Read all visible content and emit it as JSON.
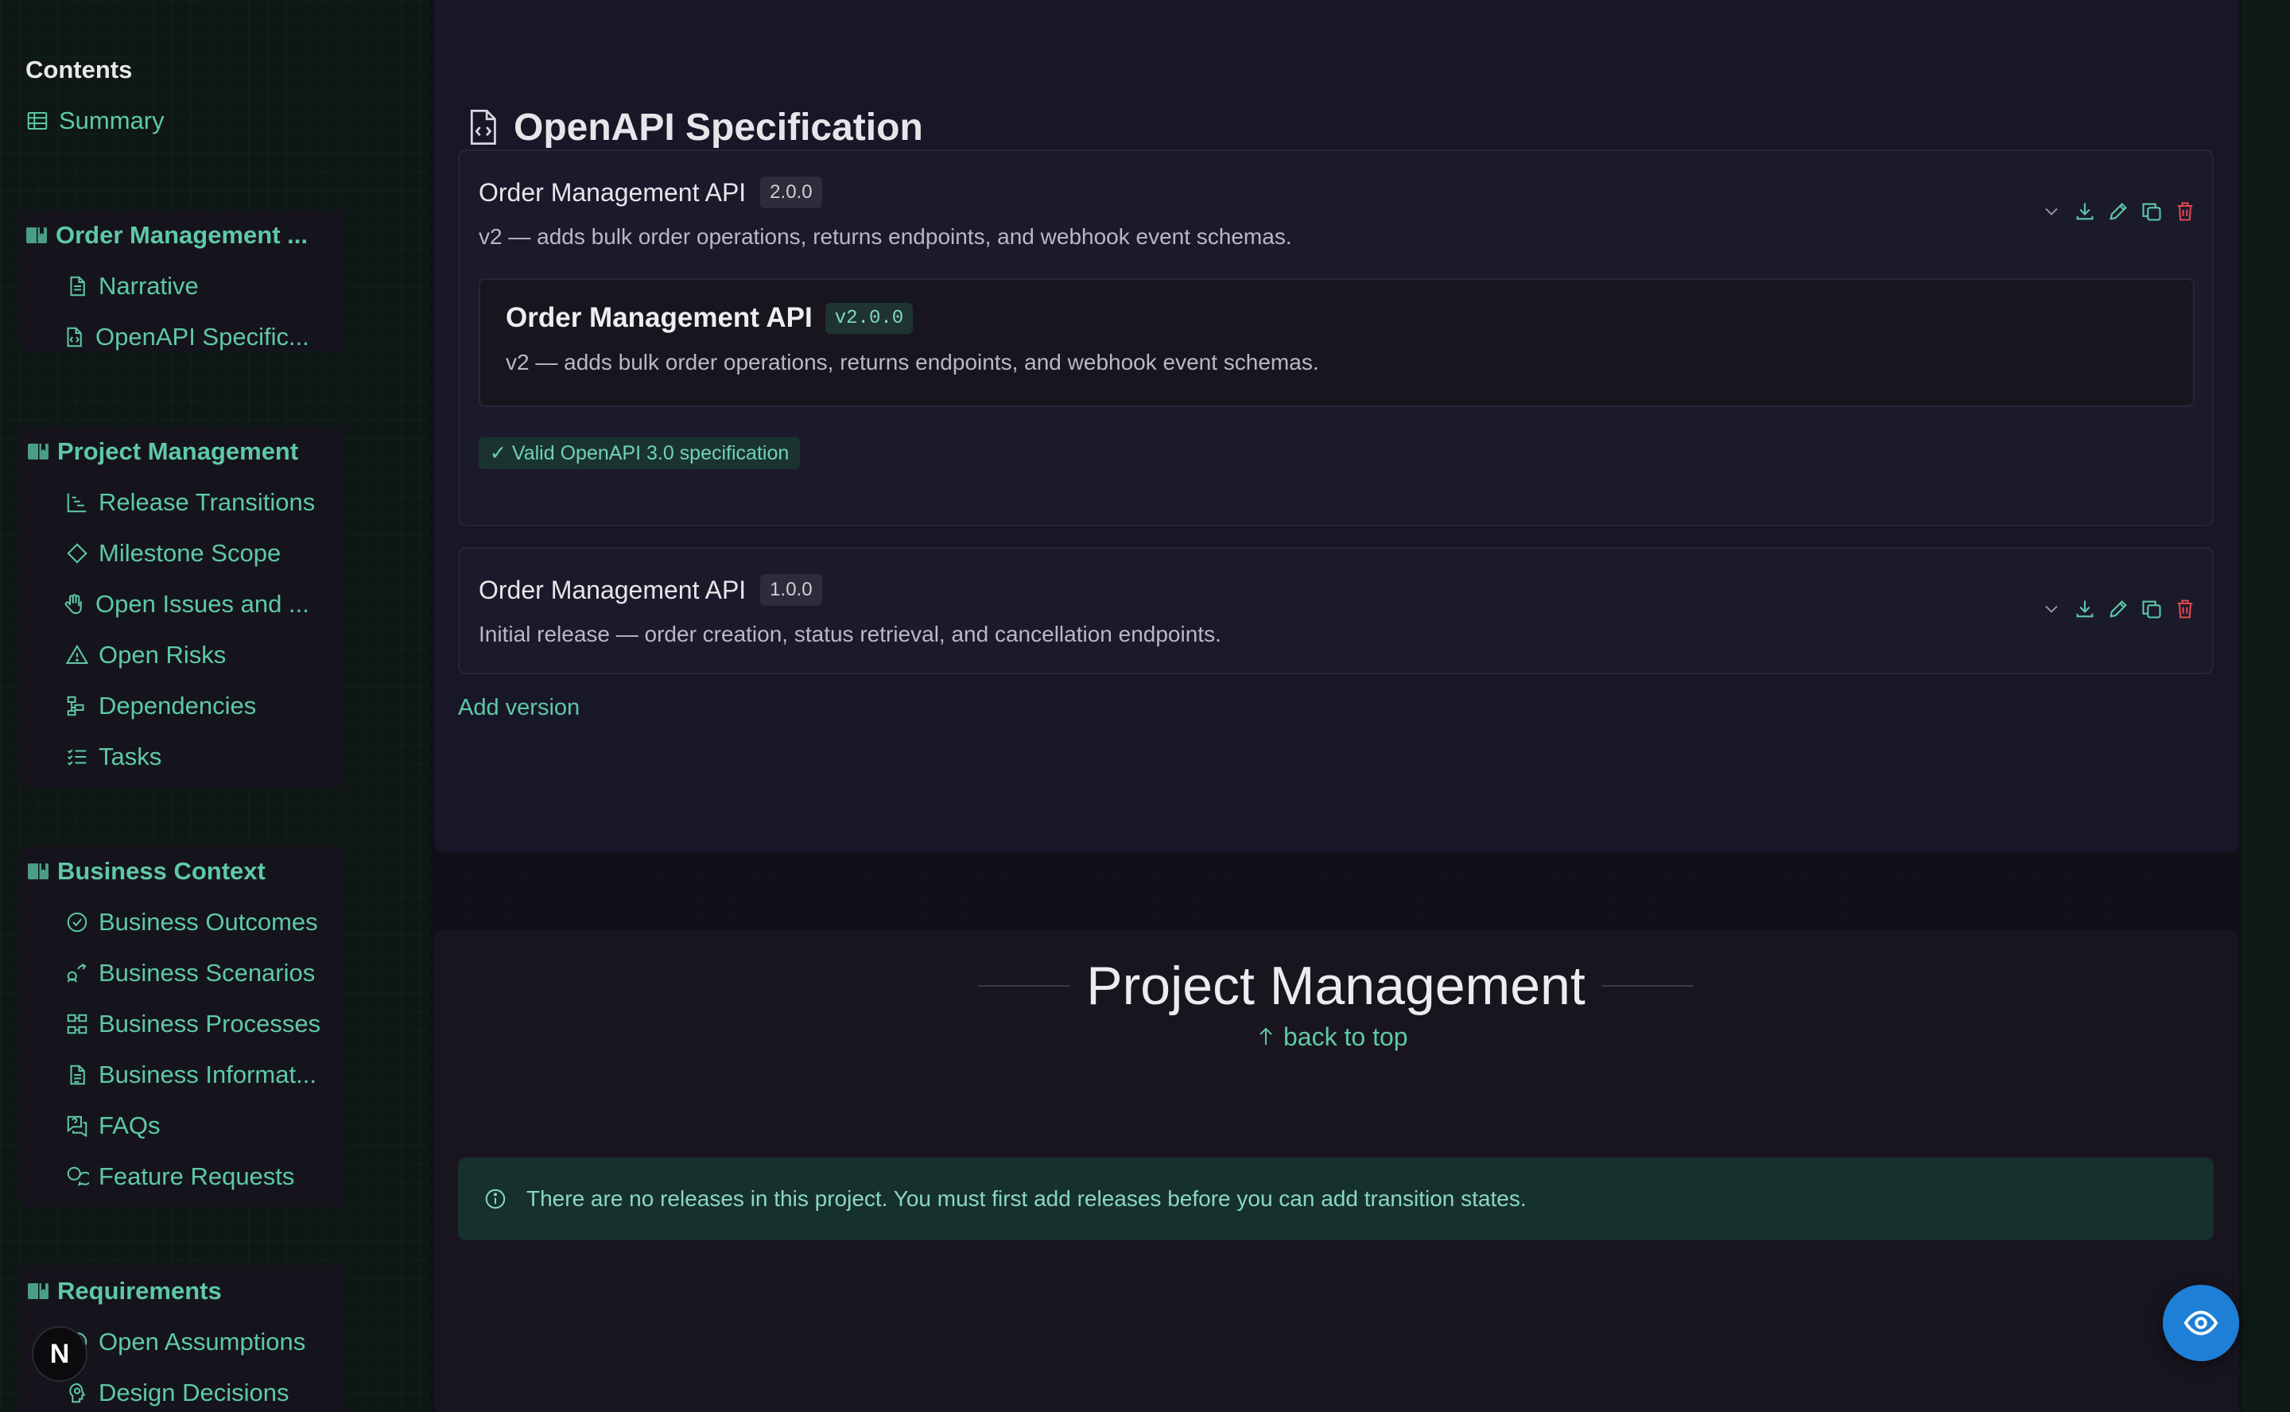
{
  "sidebar": {
    "contents_title": "Contents",
    "summary_label": "Summary",
    "groups": [
      {
        "title": "Order Management ...",
        "items": [
          "Narrative",
          "OpenAPI Specific..."
        ]
      },
      {
        "title": "Project Management",
        "items": [
          "Release Transitions",
          "Milestone Scope",
          "Open Issues and ...",
          "Open Risks",
          "Dependencies",
          "Tasks"
        ]
      },
      {
        "title": "Business Context",
        "items": [
          "Business Outcomes",
          "Business Scenarios",
          "Business Processes",
          "Business Informat...",
          "FAQs",
          "Feature Requests"
        ]
      },
      {
        "title": "Requirements",
        "items": [
          "Open Assumptions",
          "Design Decisions"
        ]
      }
    ],
    "avatar_letter": "N"
  },
  "main": {
    "spec_title": "OpenAPI Specification",
    "versions": [
      {
        "name": "Order Management API",
        "version": "2.0.0",
        "description": "v2 — adds bulk order operations, returns endpoints, and webhook event schemas.",
        "preview": {
          "name": "Order Management API",
          "version": "v2.0.0",
          "description": "v2 — adds bulk order operations, returns endpoints, and webhook event schemas."
        },
        "valid_label": "✓ Valid OpenAPI 3.0 specification"
      },
      {
        "name": "Order Management API",
        "version": "1.0.0",
        "description": "Initial release — order creation, status retrieval, and cancellation endpoints."
      }
    ],
    "add_version_label": "Add version",
    "section_heading": "Project Management",
    "back_to_top_label": "back to top",
    "info_message": "There are no releases in this project. You must first add releases before you can add transition states."
  },
  "colors": {
    "accent": "#5ec9a6",
    "danger": "#e0484f",
    "fab": "#1e7fd6"
  }
}
